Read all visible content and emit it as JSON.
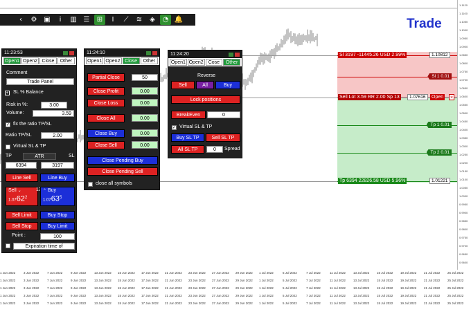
{
  "title": "Trade",
  "toolbar": {
    "icons": [
      "back-icon",
      "gear-icon",
      "camera-icon",
      "info-icon",
      "chart-icon",
      "list-icon",
      "template-icon",
      "text-icon",
      "trendline-icon",
      "fib-icon",
      "shield-icon",
      "pie-icon",
      "bell-icon"
    ],
    "glyphs": [
      "‹",
      "⚙",
      "▣",
      "i",
      "▥",
      "☰",
      "⊞",
      "I",
      "⟋",
      "≋",
      "◈",
      "◔",
      "🔔"
    ]
  },
  "levels": {
    "sl": {
      "label": "Sl 3197 -11445.26 USD",
      "pct": "2.99%",
      "box": "1.10812"
    },
    "sl1": {
      "label": "Sl 1 0.01"
    },
    "sell": {
      "label": "Sell Lot 3.59 RR 2.00 Sp 13",
      "box": "1.07616",
      "open": "Open"
    },
    "tp1": {
      "label": "Tp 1 0.01"
    },
    "tp2": {
      "label": "Tp 2 0.01"
    },
    "tp": {
      "label": "Tp 6394 22826.58 USD",
      "pct": "5.96%",
      "box": "1.01221"
    }
  },
  "panel1": {
    "time": "11:23:53",
    "tabs": [
      "Open1",
      "Open2",
      "Close",
      "Other"
    ],
    "comment_label": "Comment",
    "comment_value": "Trade Panel",
    "sl_balance": "SL % Balance",
    "risk_label": "Risk in %:",
    "risk_value": "3.00",
    "volume_label": "Volume:",
    "volume_value": "3.59",
    "fix_ratio": "fix the ratio TP/SL",
    "ratio_label": "Ratio TP/SL",
    "ratio_value": "2.00",
    "virtual_sl_tp": "Virtual SL & TP",
    "tp_label": "TP",
    "atr_label": "ATR",
    "sl_label": "SL",
    "tp_value": "6394",
    "sl_value": "3197",
    "line_sell": "Line Sell",
    "line_buy": "Line Buy",
    "sell_label": "Sell",
    "sell_price_small": "1.07",
    "sell_price_big": "62",
    "sell_price_sup": "2",
    "spread": "13",
    "buy_label": "Buy",
    "buy_price_small": "1.07",
    "buy_price_big": "63",
    "buy_price_sup": "5",
    "sell_limit": "Sell Limit",
    "buy_stop": "Buy Stop",
    "sell_stop": "Sell Stop",
    "buy_limit": "Buy Limit",
    "point_label": "Point :",
    "point_value": "100",
    "expiration": "Expiration time of"
  },
  "panel2": {
    "time": "11:24:10",
    "tabs": [
      "Open1",
      "Open2",
      "Close",
      "Other"
    ],
    "partial_close": "Partial Close",
    "partial_value": "50",
    "close_profit": "Close Profit",
    "close_profit_val": "0.00",
    "close_loss": "Close Loss",
    "close_loss_val": "0.00",
    "close_all": "Close All",
    "close_all_val": "0.00",
    "close_buy": "Close Buy",
    "close_buy_val": "0.00",
    "close_sell": "Close Sell",
    "close_sell_val": "0.00",
    "close_pending_buy": "Close Pending Buy",
    "close_pending_sell": "Close Pending Sell",
    "close_all_symbols": "close all symbols"
  },
  "panel3": {
    "time": "11:24:20",
    "tabs": [
      "Open1",
      "Open2",
      "Cose",
      "Other"
    ],
    "reverse": "Reverse",
    "sell": "Sell",
    "all": "All",
    "buy": "Buy",
    "lock": "Lock positions",
    "breakeven": "BreakEven",
    "breakeven_val": "0",
    "virtual": "Virtual SL & TP",
    "buy_sl_tp": "Buy SL TP",
    "sell_sl_tp": "Sell SL TP",
    "all_sl_tp": "All SL TP",
    "spread_val": "0",
    "spread": "Spread"
  },
  "price_axis": [
    "1.1120",
    "1.1100",
    "1.1050",
    "1.1000",
    "1.0950",
    "1.0900",
    "1.0850",
    "1.0800",
    "1.0750",
    "1.0700",
    "1.0650",
    "1.0600",
    "1.0550",
    "1.0500",
    "1.0450",
    "1.0400",
    "1.0350",
    "1.0300",
    "1.0250",
    "1.0200",
    "1.0150",
    "1.0100",
    "1.0050",
    "1.0000",
    "0.9950",
    "0.9900",
    "0.9850",
    "0.9800",
    "0.9750",
    "0.9700",
    "0.9650",
    "0.9600"
  ],
  "time_axis": [
    "1 Jun 2022",
    "3 Jun 2022",
    "7 Jun 2022",
    "9 Jun 2022",
    "13 Jun 2022",
    "15 Jun 2022",
    "17 Jun 2022",
    "21 Jun 2022",
    "23 Jun 2022",
    "27 Jun 2022",
    "29 Jun 2022",
    "1 Jul 2022",
    "5 Jul 2022",
    "7 Jul 2022",
    "11 Jul 2022",
    "13 Jul 2022",
    "15 Jul 2022",
    "19 Jul 2022",
    "21 Jul 2022",
    "25 Jul 2022"
  ]
}
